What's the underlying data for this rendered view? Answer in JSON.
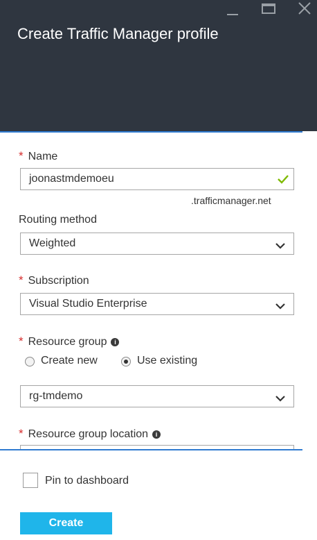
{
  "window": {
    "title": "Create Traffic Manager profile",
    "minimize_icon": "minimize-icon",
    "maximize_icon": "maximize-icon",
    "close_icon": "close-icon"
  },
  "form": {
    "name": {
      "label": "Name",
      "required": "*",
      "value": "joonastmdemoeu",
      "suffix": ".trafficmanager.net",
      "valid_icon": "checkmark-icon"
    },
    "routing_method": {
      "label": "Routing method",
      "value": "Weighted"
    },
    "subscription": {
      "label": "Subscription",
      "required": "*",
      "value": "Visual Studio Enterprise"
    },
    "resource_group": {
      "label": "Resource group",
      "required": "*",
      "options": [
        {
          "label": "Create new",
          "selected": false
        },
        {
          "label": "Use existing",
          "selected": true
        }
      ],
      "value": "rg-tmdemo"
    },
    "resource_group_location": {
      "label": "Resource group location",
      "required": "*"
    }
  },
  "footer": {
    "pin_label": "Pin to dashboard",
    "pin_checked": false,
    "create_label": "Create"
  },
  "colors": {
    "header_bg": "#2f3640",
    "accent": "#1fb5ea",
    "required": "#d62d2d",
    "valid": "#7fba00"
  }
}
